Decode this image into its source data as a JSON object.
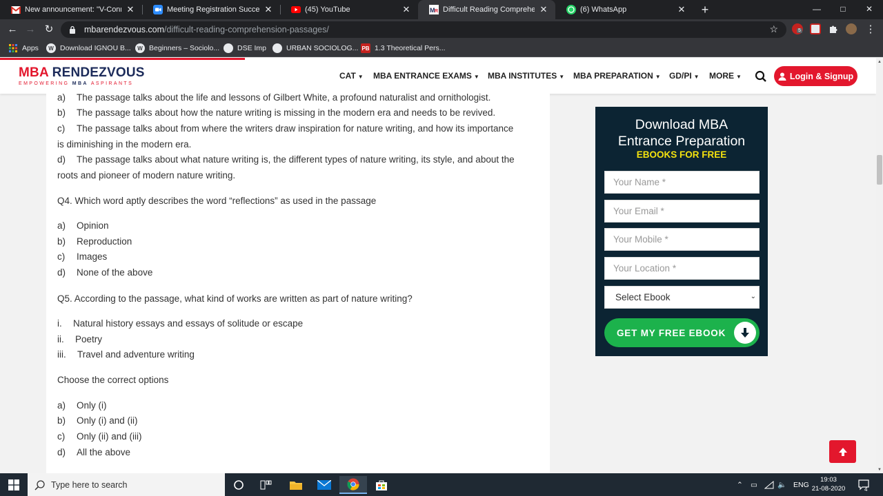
{
  "browser": {
    "tabs": [
      {
        "title": "New announcement: \"V-Connect",
        "icon": "gmail-icon",
        "active": false
      },
      {
        "title": "Meeting Registration Success - Z",
        "icon": "zoom-icon",
        "active": false
      },
      {
        "title": "(45) YouTube",
        "icon": "youtube-icon",
        "active": false
      },
      {
        "title": "Difficult Reading Comprehension",
        "icon": "mr-icon",
        "active": true
      },
      {
        "title": "(6) WhatsApp",
        "icon": "whatsapp-icon",
        "active": false
      }
    ],
    "close_glyph": "✕",
    "new_tab_glyph": "+",
    "url_host": "mbarendezvous.com",
    "url_path": "/difficult-reading-comprehension-passages/",
    "ext_badge": "5",
    "bookmarks": [
      {
        "label": "Apps",
        "icon": "apps-grid-icon"
      },
      {
        "label": "Download IGNOU B...",
        "icon": "wordpress-icon"
      },
      {
        "label": "Beginners – Sociolo...",
        "icon": "wordpress-icon"
      },
      {
        "label": "DSE Imp",
        "icon": "globe-icon"
      },
      {
        "label": "URBAN SOCIOLOG...",
        "icon": "globe-icon"
      },
      {
        "label": "1.3 Theoretical Pers...",
        "icon": "pb-icon",
        "icon_text": "PB"
      }
    ]
  },
  "site": {
    "logo_main_a": "MBA",
    "logo_main_b": " RENDEZVOUS",
    "logo_sub_a": "EMPOWERING ",
    "logo_sub_b": "MBA",
    "logo_sub_c": " ASPIRANTS",
    "menu": [
      "CAT",
      "MBA ENTRANCE EXAMS",
      "MBA INSTITUTES",
      "MBA PREPARATION",
      "GD/PI",
      "MORE"
    ],
    "login_label": "Login & Signup",
    "colors": {
      "brand_red": "#e3172d",
      "brand_navy": "#1c2b5a",
      "widget_bg": "#0c2433",
      "cta_green": "#1cb24c",
      "cta_yellow": "#f4e20e"
    }
  },
  "article": {
    "lines": [
      {
        "letter": "a)",
        "text": "The passage talks about the life and lessons of Gilbert White, a profound naturalist and ornithologist."
      },
      {
        "letter": "b)",
        "text": "The passage talks about how the nature writing is missing in the modern era and needs to be revived."
      },
      {
        "letter": "c)",
        "text": "The passage talks about from where the writers draw inspiration for nature writing, and how its importance"
      },
      {
        "letter": "",
        "text": "is diminishing in the modern era."
      },
      {
        "letter": "d)",
        "text": "The passage talks about what nature writing is, the different types of nature writing, its style, and about the"
      },
      {
        "letter": "",
        "text": "roots and pioneer of modern nature writing."
      },
      {
        "letter": "",
        "text": "Q4. Which word aptly describes the word “reflections” as used in the passage"
      },
      {
        "letter": "a)",
        "text": "Opinion"
      },
      {
        "letter": "b)",
        "text": "Reproduction"
      },
      {
        "letter": "c)",
        "text": "Images"
      },
      {
        "letter": "d)",
        "text": "None of the above"
      },
      {
        "letter": "",
        "text": "Q5. According to the passage, what kind of works are written as part of nature writing?"
      },
      {
        "letter": "i.",
        "text": "Natural history essays and essays of solitude or escape"
      },
      {
        "letter": "ii.",
        "text": "Poetry"
      },
      {
        "letter": "iii.",
        "text": "Travel and adventure writing"
      },
      {
        "letter": "",
        "text": "Choose the correct options"
      },
      {
        "letter": "a)",
        "text": "Only (i)"
      },
      {
        "letter": "b)",
        "text": "Only (i) and (ii)"
      },
      {
        "letter": "c)",
        "text": "Only (ii) and (iii)"
      },
      {
        "letter": "d)",
        "text": "All the above"
      }
    ]
  },
  "widget": {
    "title_line1": "Download MBA",
    "title_line2": "Entrance Preparation",
    "subtitle": "EBOOKS FOR FREE",
    "name_placeholder": "Your Name *",
    "email_placeholder": "Your Email *",
    "mobile_placeholder": "Your Mobile *",
    "location_placeholder": "Your Location *",
    "select_value": "Select Ebook",
    "cta_label": "GET MY FREE EBOOK"
  },
  "taskbar": {
    "search_placeholder": "Type here to search",
    "lang": "ENG",
    "time": "19:03",
    "date": "21-08-2020",
    "notif_count": "4"
  }
}
